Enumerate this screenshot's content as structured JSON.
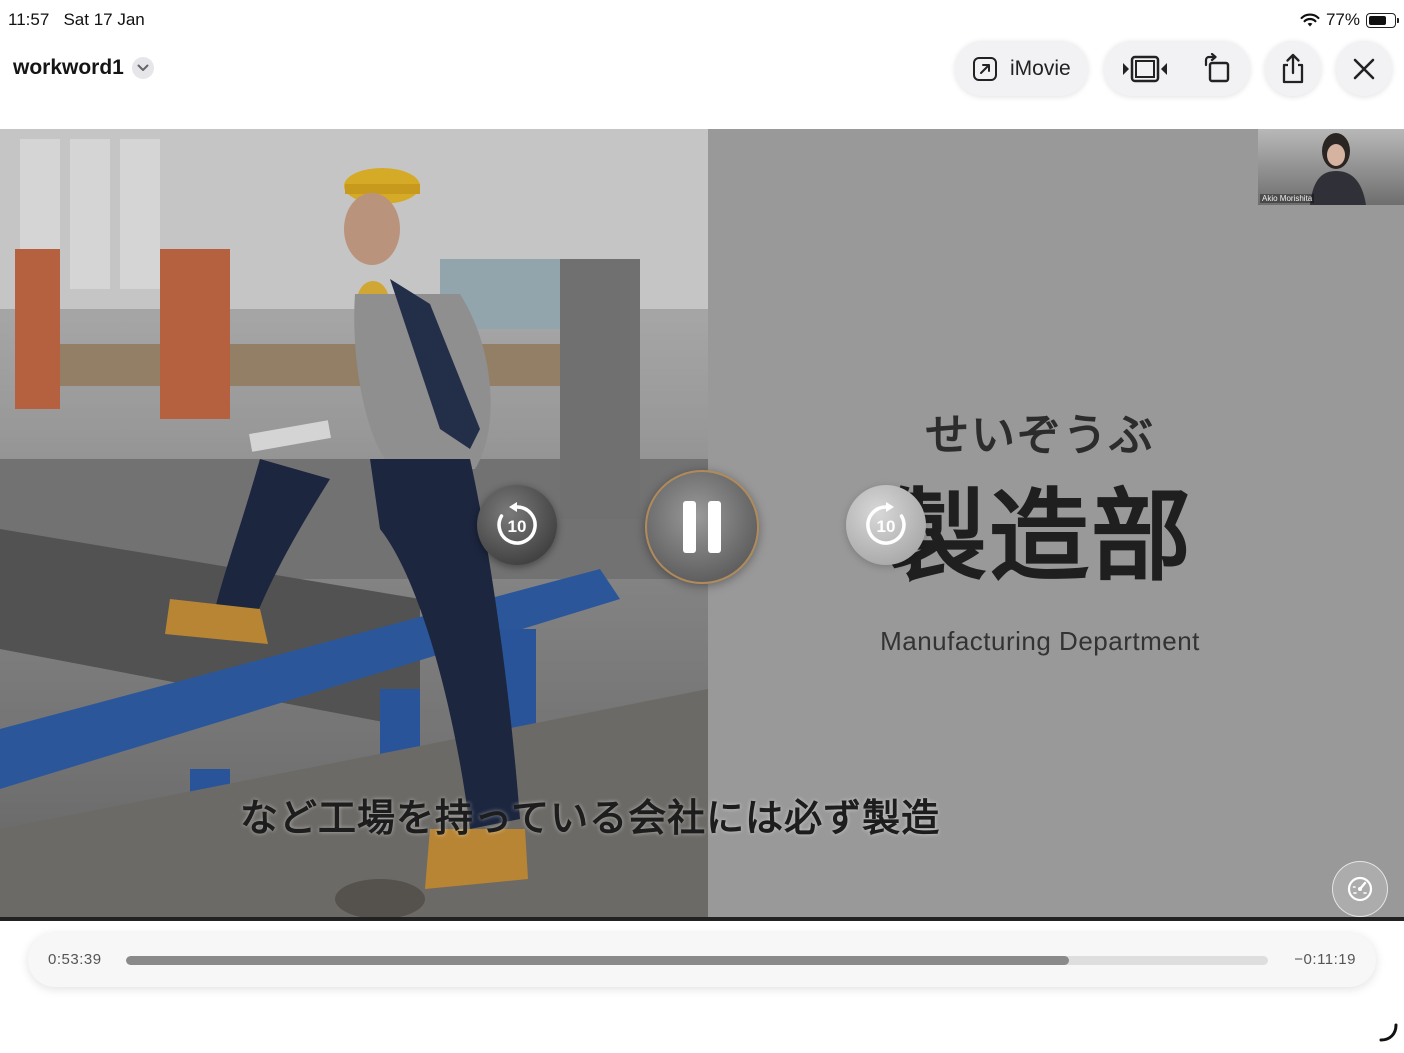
{
  "status_bar": {
    "time": "11:57",
    "date": "Sat 17 Jan",
    "battery": "77%",
    "battery_level": 0.77,
    "wifi_icon": "wifi-icon"
  },
  "header": {
    "title": "workword1",
    "imovie_label": "iMovie",
    "icons": [
      "share-out-icon",
      "trim-icon",
      "rotate-icon",
      "share-icon",
      "close-icon"
    ]
  },
  "video": {
    "slide_kana": "せいぞうぶ",
    "slide_kanji": "製造部",
    "slide_english": "Manufacturing Department",
    "subtitle": "など工場を持っている会社には必ず製造",
    "pip_name": "Akio Morishita",
    "skip_back_label": "10",
    "skip_forward_label": "10"
  },
  "playback": {
    "elapsed": "0:53:39",
    "remaining": "−0:11:19",
    "progress": 0.826
  }
}
